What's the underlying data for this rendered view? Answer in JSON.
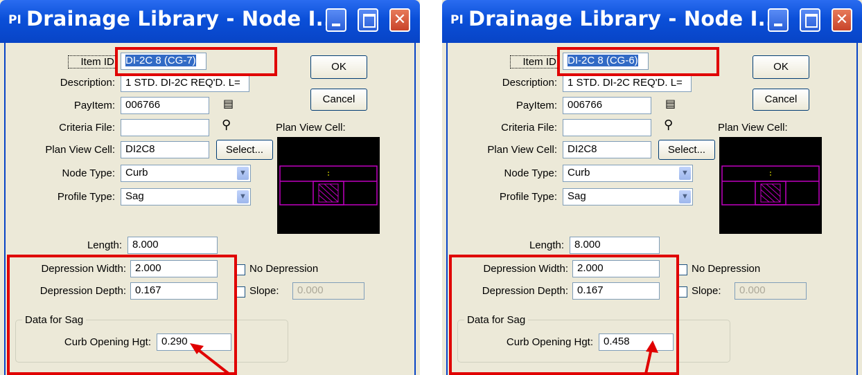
{
  "windows": [
    {
      "title": "Drainage Library - Node I...",
      "title_logo": "PI",
      "fields": {
        "item_id_label": "Item ID:",
        "item_id": "DI-2C 8 (CG-7)",
        "description_label": "Description:",
        "description": "1 STD. DI-2C REQ'D. L=",
        "payitem_label": "PayItem:",
        "payitem": "006766",
        "criteria_label": "Criteria File:",
        "criteria": "",
        "plan_view_label": "Plan View Cell:",
        "plan_view": "DI2C8",
        "plan_view_cell_label": "Plan View Cell:",
        "node_type_label": "Node Type:",
        "node_type": "Curb",
        "profile_type_label": "Profile Type:",
        "profile_type": "Sag",
        "length_label": "Length:",
        "length": "8.000",
        "dep_width_label": "Depression Width:",
        "dep_width": "2.000",
        "dep_depth_label": "Depression Depth:",
        "dep_depth": "0.167",
        "no_depression_label": "No Depression",
        "slope_label": "Slope:",
        "slope": "0.000",
        "sag_group_label": "Data for Sag",
        "curb_opening_label": "Curb Opening Hgt:",
        "curb_opening": "0.290"
      },
      "buttons": {
        "ok": "OK",
        "cancel": "Cancel",
        "select": "Select..."
      }
    },
    {
      "title": "Drainage Library - Node I...",
      "title_logo": "PI",
      "fields": {
        "item_id_label": "Item ID:",
        "item_id": "DI-2C 8 (CG-6)",
        "description_label": "Description:",
        "description": "1 STD. DI-2C REQ'D. L=",
        "payitem_label": "PayItem:",
        "payitem": "006766",
        "criteria_label": "Criteria File:",
        "criteria": "",
        "plan_view_label": "Plan View Cell:",
        "plan_view": "DI2C8",
        "plan_view_cell_label": "Plan View Cell:",
        "node_type_label": "Node Type:",
        "node_type": "Curb",
        "profile_type_label": "Profile Type:",
        "profile_type": "Sag",
        "length_label": "Length:",
        "length": "8.000",
        "dep_width_label": "Depression Width:",
        "dep_width": "2.000",
        "dep_depth_label": "Depression Depth:",
        "dep_depth": "0.167",
        "no_depression_label": "No Depression",
        "slope_label": "Slope:",
        "slope": "0.000",
        "sag_group_label": "Data for Sag",
        "curb_opening_label": "Curb Opening Hgt:",
        "curb_opening": "0.458"
      },
      "buttons": {
        "ok": "OK",
        "cancel": "Cancel",
        "select": "Select..."
      }
    }
  ],
  "colors": {
    "highlight": "#e00000",
    "titlebar": "#0a4fd8",
    "cell_outline": "#c000c0"
  }
}
